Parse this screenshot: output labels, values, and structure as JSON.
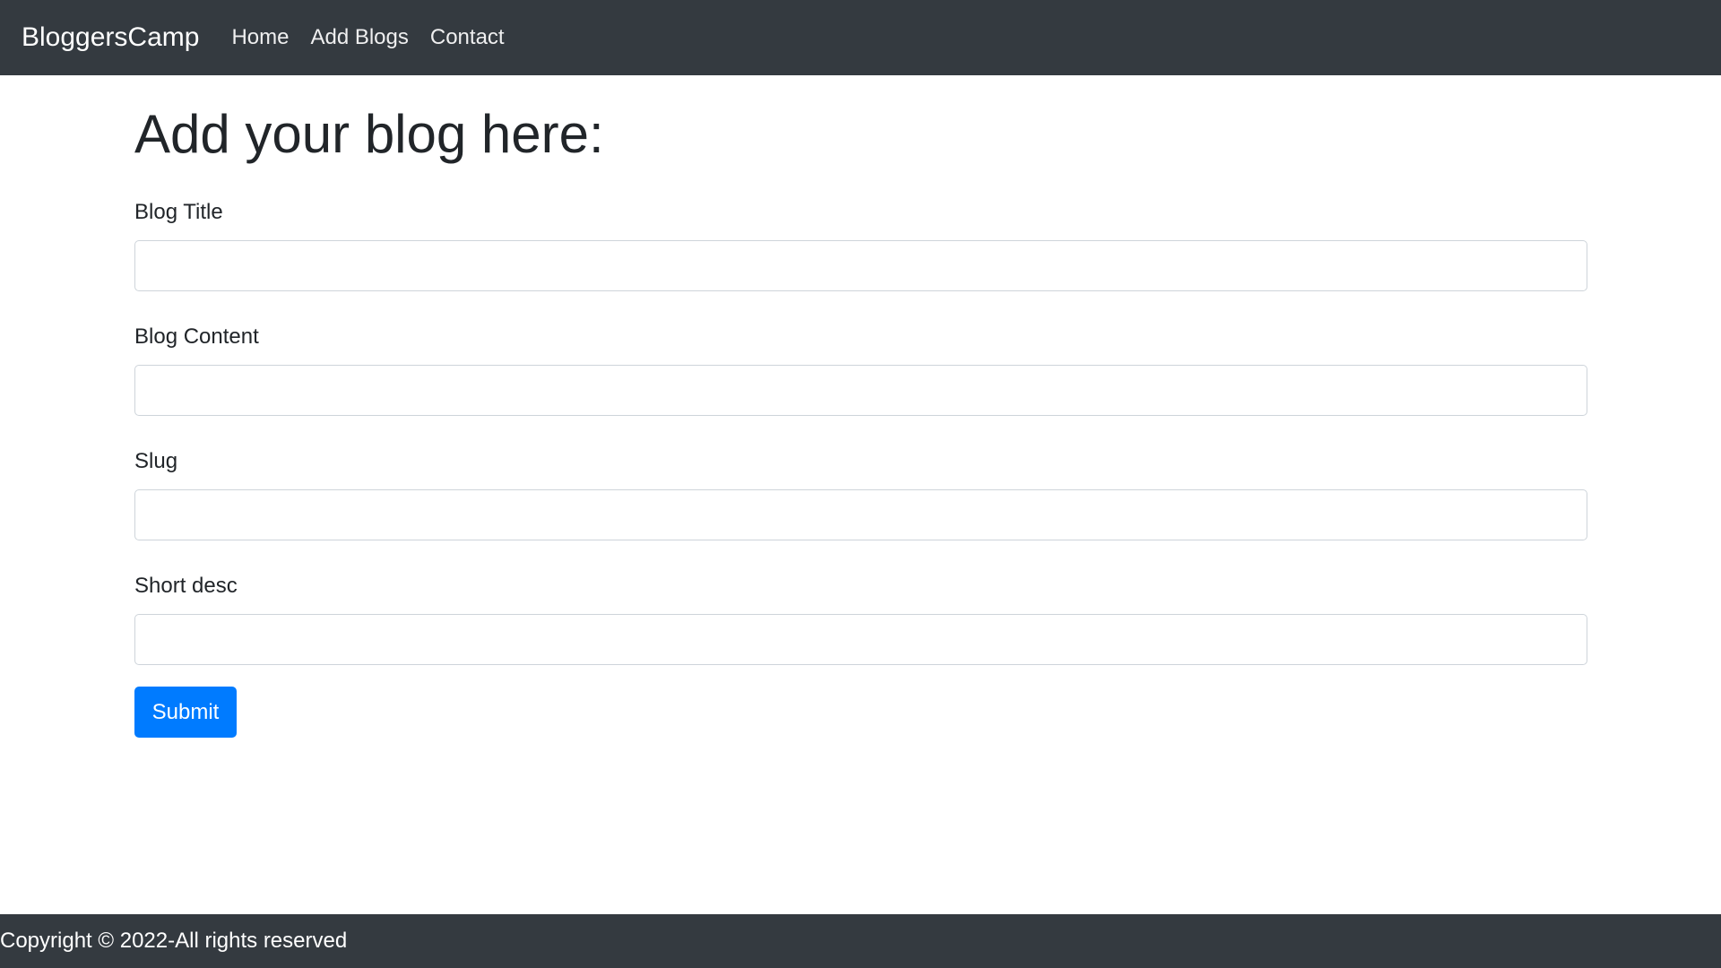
{
  "navbar": {
    "brand": "BloggersCamp",
    "links": [
      "Home",
      "Add Blogs",
      "Contact"
    ]
  },
  "main": {
    "title": "Add your blog here:",
    "fields": [
      {
        "label": "Blog Title",
        "value": "",
        "placeholder": ""
      },
      {
        "label": "Blog Content",
        "value": "",
        "placeholder": ""
      },
      {
        "label": "Slug",
        "value": "",
        "placeholder": ""
      },
      {
        "label": "Short desc",
        "value": "",
        "placeholder": ""
      }
    ],
    "submit_label": "Submit"
  },
  "footer": {
    "text": "Copyright © 2022-All rights reserved"
  },
  "colors": {
    "navbar_bg": "#343a40",
    "primary": "#007bff"
  }
}
